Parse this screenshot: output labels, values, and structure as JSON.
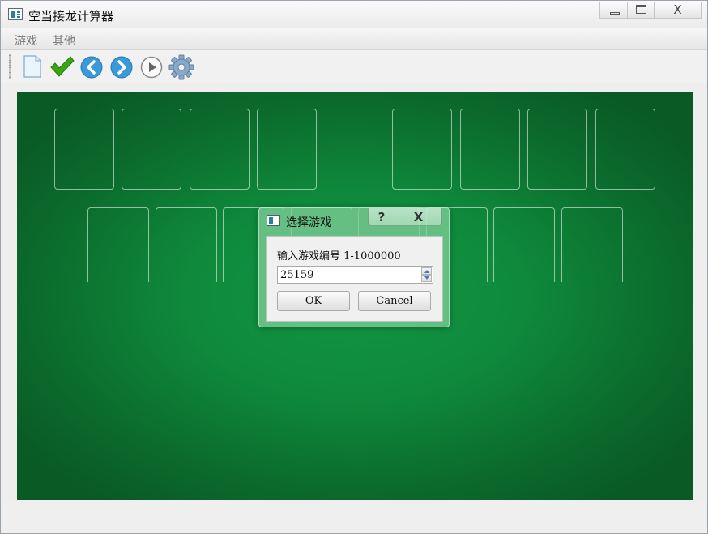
{
  "window": {
    "title": "空当接龙计算器",
    "close_glyph": "X"
  },
  "menu": [
    {
      "label": "游戏"
    },
    {
      "label": "其他"
    }
  ],
  "toolbar": {
    "tools": [
      "new-document-icon",
      "checkmark-icon",
      "back-arrow-icon",
      "forward-arrow-icon",
      "play-icon",
      "settings-gear-icon"
    ]
  },
  "colors": {
    "felt_center": "#129443",
    "felt_edge": "#0a5a25",
    "accent_blue": "#3a9ad9",
    "check_green": "#3aa512"
  },
  "dialog": {
    "title": "选择游戏",
    "help_glyph": "?",
    "close_glyph": "X",
    "prompt": "输入游戏编号 1-1000000",
    "game_number": "25159",
    "ok_label": "OK",
    "cancel_label": "Cancel"
  }
}
